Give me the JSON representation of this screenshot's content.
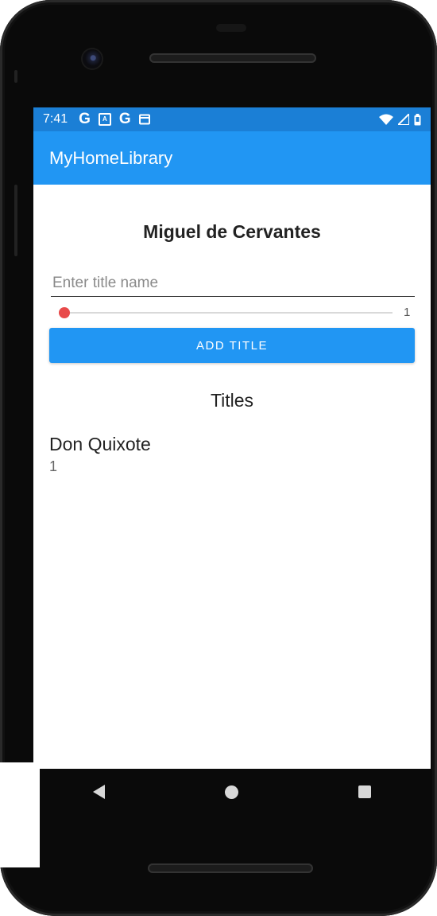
{
  "status_bar": {
    "time": "7:41",
    "left_icons": [
      "google-g-icon",
      "notification-a-icon",
      "google-g-icon",
      "calendar-icon"
    ],
    "right_icons": [
      "wifi-icon",
      "signal-icon",
      "battery-icon"
    ],
    "color": "#1b7fd6"
  },
  "app_bar": {
    "title": "MyHomeLibrary",
    "color": "#2196f3"
  },
  "author": {
    "name": "Miguel de Cervantes"
  },
  "form": {
    "title_input_placeholder": "Enter title name",
    "title_input_value": "",
    "slider_value": "1",
    "slider_thumb_color": "#e84a4a",
    "add_button_label": "ADD TITLE"
  },
  "titles": {
    "heading": "Titles",
    "items": [
      {
        "name": "Don Quixote",
        "count": "1"
      }
    ]
  },
  "nav_bar": {
    "icons": [
      "back-icon",
      "home-icon",
      "recents-icon"
    ]
  }
}
